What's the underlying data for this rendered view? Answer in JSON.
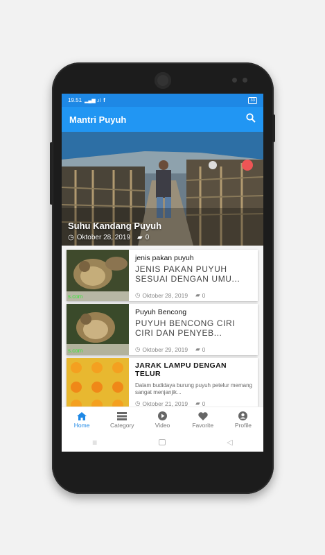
{
  "statusbar": {
    "time": "19.51",
    "indicators": "὏6 .὏6 .ıl",
    "battery": "33"
  },
  "appbar": {
    "title": "Mantri Puyuh",
    "search_icon": "search-icon"
  },
  "hero": {
    "title": "Suhu Kandang Puyuh",
    "date": "Oktober 28, 2019",
    "comments": "0"
  },
  "posts": [
    {
      "category": "jenis pakan puyuh",
      "title": "JENIS PAKAN PUYUH SESUAI DENGAN UMU...",
      "date": "Oktober 28, 2019",
      "comments": "0",
      "watermark": "s.com"
    },
    {
      "category": "Puyuh Bencong",
      "title": "PUYUH BENCONG CIRI CIRI DAN PENYEB...",
      "date": "Oktober 29, 2019",
      "comments": "0",
      "watermark": "s.com"
    },
    {
      "title": "JARAK LAMPU DENGAN TELUR",
      "excerpt": "Dalam budidaya burung puyuh petelur memang sangat menjanjik...",
      "date": "Oktober 21, 2019",
      "comments": "0"
    }
  ],
  "nav": {
    "home": "Home",
    "category": "Category",
    "video": "Video",
    "favorite": "Favorite",
    "profile": "Profile"
  },
  "colors": {
    "primary": "#2196f3",
    "statusbar": "#1e88e5"
  }
}
